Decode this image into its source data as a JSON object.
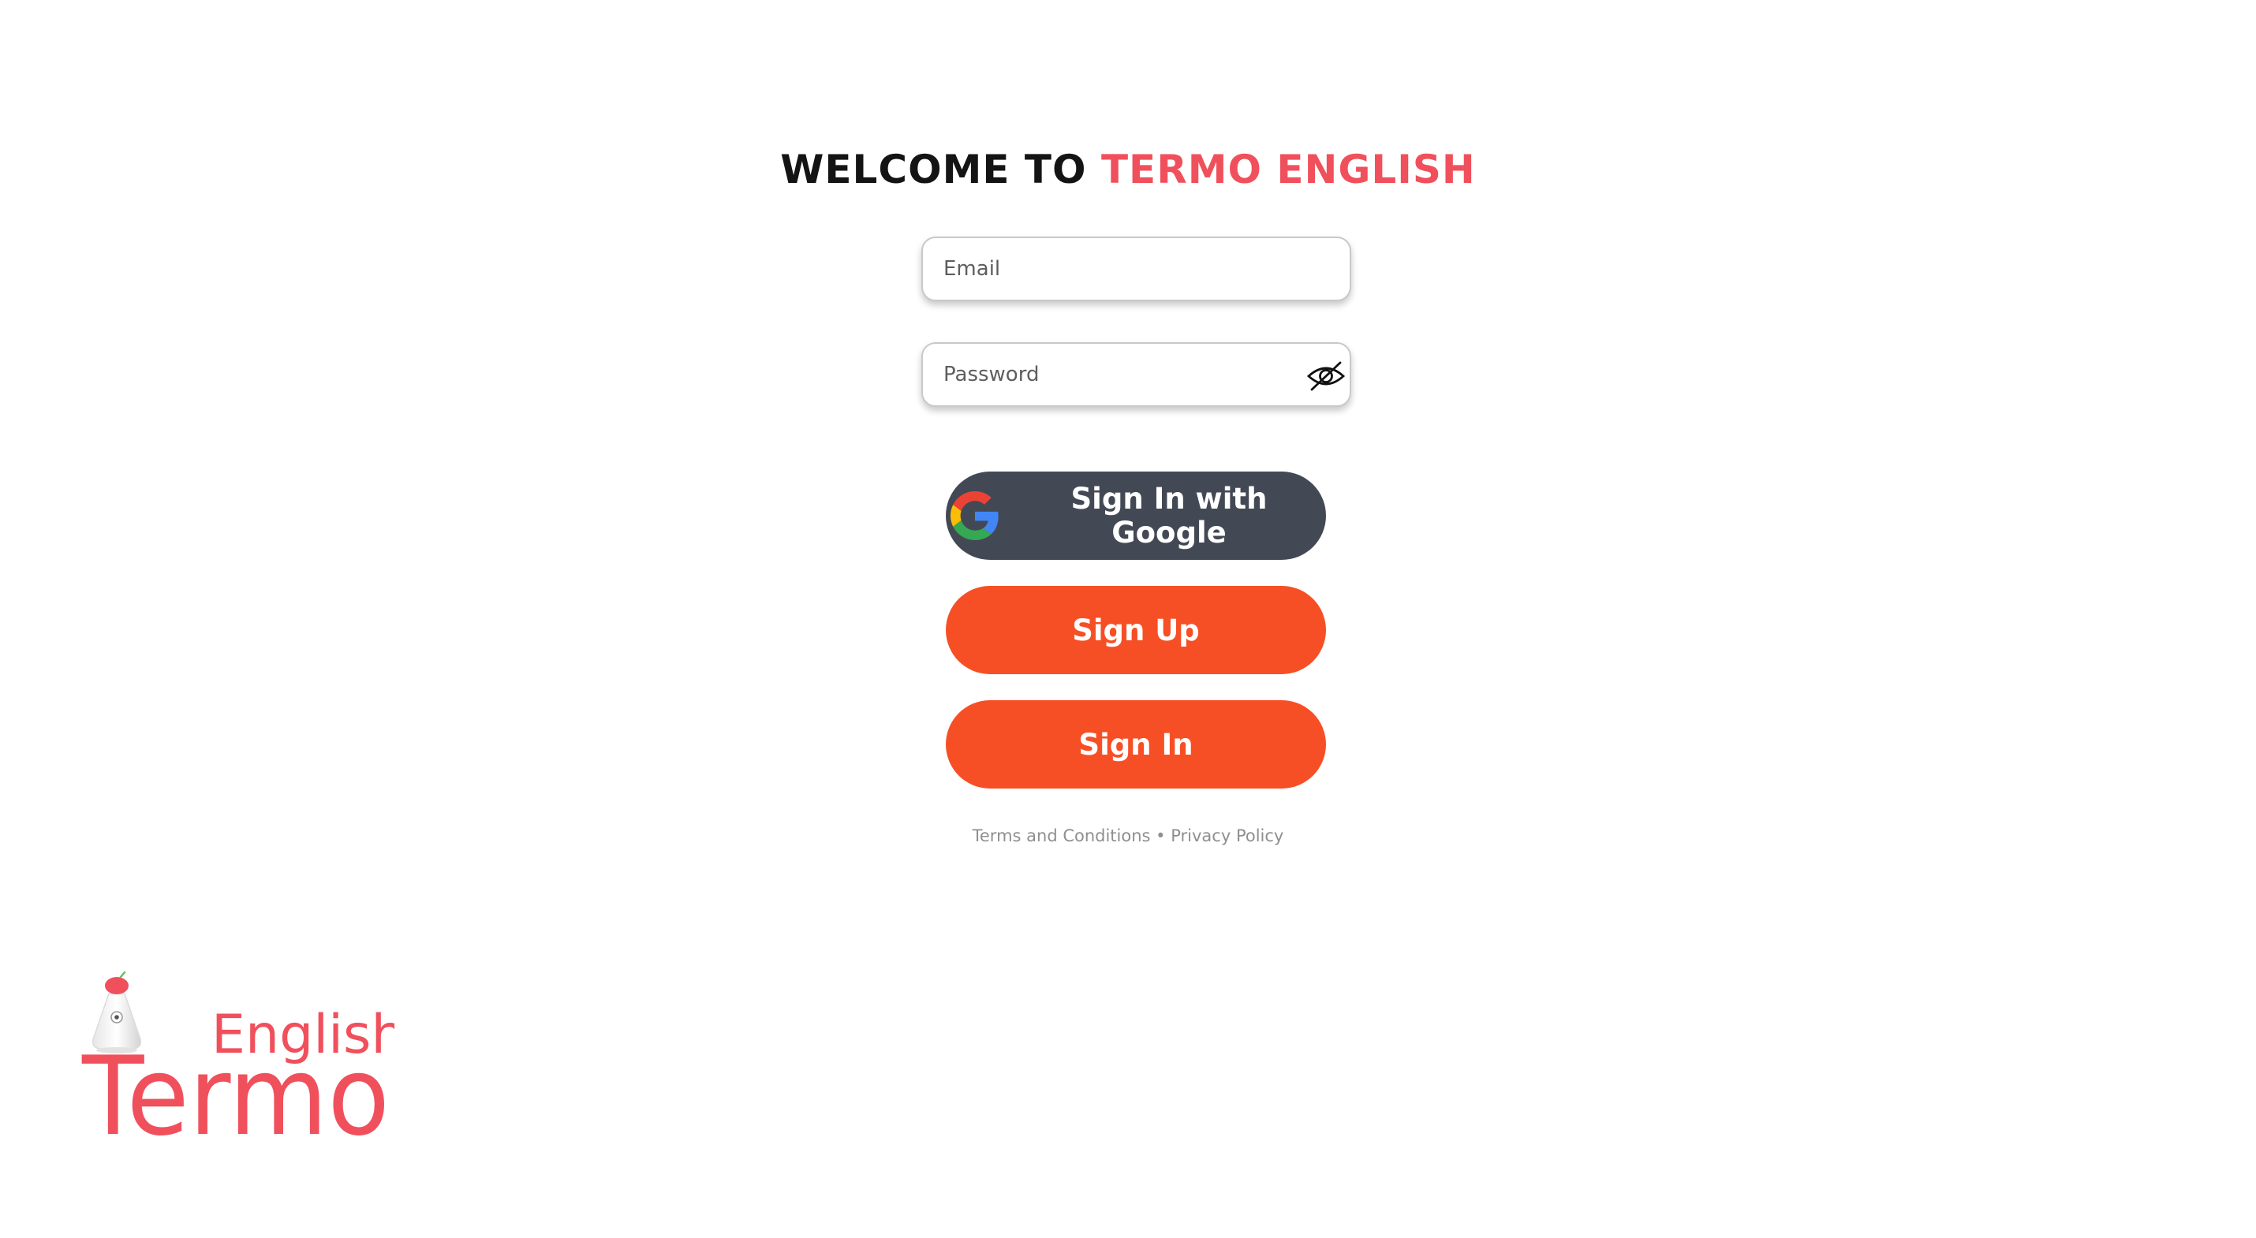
{
  "title": {
    "prefix": "WELCOME TO ",
    "brand": "TERMO ENGLISH"
  },
  "form": {
    "email_placeholder": "Email",
    "password_placeholder": "Password",
    "password_visibility_icon": "eye-slash-icon"
  },
  "buttons": {
    "google_label": "Sign In with Google",
    "google_icon": "google-icon",
    "signup_label": "Sign Up",
    "signin_label": "Sign In"
  },
  "legal": {
    "terms": "Terms and Conditions",
    "separator": " • ",
    "privacy": "Privacy Policy"
  },
  "logo": {
    "line1": "English",
    "line2": "Termo"
  },
  "colors": {
    "brand_red": "#f0505c",
    "button_orange": "#f74f25",
    "google_button": "#434954"
  }
}
